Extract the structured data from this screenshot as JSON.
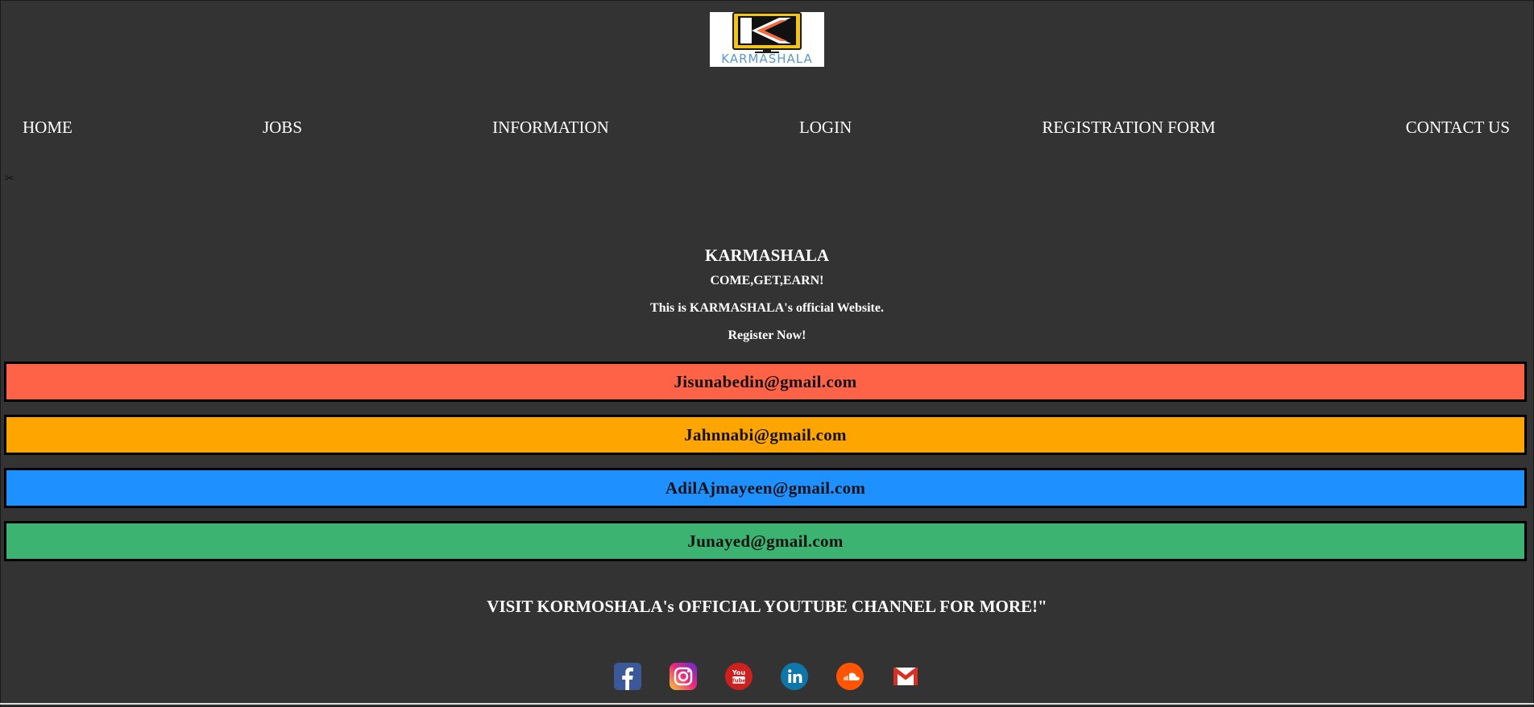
{
  "logo": {
    "text": "KARMASHALA",
    "icon": "karmashala-k-monitor-logo"
  },
  "nav": {
    "items": [
      {
        "label": "HOME"
      },
      {
        "label": "JOBS"
      },
      {
        "label": "INFORMATION"
      },
      {
        "label": "LOGIN"
      },
      {
        "label": "REGISTRATION FORM"
      },
      {
        "label": "CONTACT US"
      }
    ]
  },
  "hero": {
    "title": "KARMASHALA",
    "slogan": "COME,GET,EARN!",
    "description": "This is KARMASHALA's official Website.",
    "cta": "Register Now!"
  },
  "emails": [
    {
      "address": "Jisunabedin@gmail.com",
      "color": "#ff6347"
    },
    {
      "address": "Jahnnabi@gmail.com",
      "color": "#ffa500"
    },
    {
      "address": "AdilAjmayeen@gmail.com",
      "color": "#1e90ff"
    },
    {
      "address": "Junayed@gmail.com",
      "color": "#3cb371"
    }
  ],
  "footer": {
    "cta": "VISIT KORMOSHALA's OFFICIAL YOUTUBE CHANNEL FOR MORE!\""
  },
  "social": [
    {
      "icon": "facebook-icon",
      "color": "#3b5998"
    },
    {
      "icon": "instagram-icon",
      "color": "#e1306c"
    },
    {
      "icon": "youtube-icon",
      "color": "#cd201f"
    },
    {
      "icon": "linkedin-icon",
      "color": "#0e76a8"
    },
    {
      "icon": "soundcloud-icon",
      "color": "#ff5500"
    },
    {
      "icon": "gmail-icon",
      "color": "#d93025"
    }
  ],
  "colors": {
    "background": "#333333",
    "text": "#ffffff"
  }
}
